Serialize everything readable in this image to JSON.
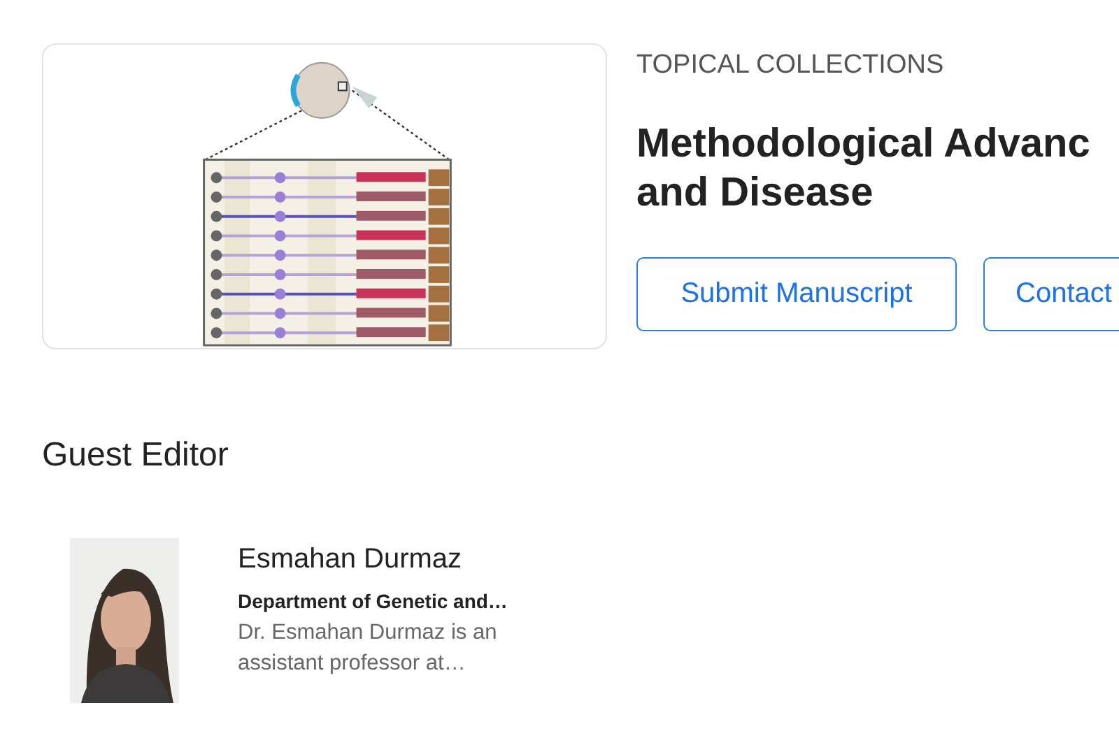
{
  "collection": {
    "eyebrow": "TOPICAL COLLECTIONS",
    "title_lines": [
      "Methodological Advanc",
      "and Disease"
    ],
    "buttons": [
      {
        "label": "Submit Manuscript"
      },
      {
        "label": "Contact"
      }
    ]
  },
  "guest_editor": {
    "heading": "Guest Editor",
    "editors": [
      {
        "name": "Esmahan Durmaz",
        "department": "Department of Genetic and…",
        "bio_lines": [
          "Dr. Esmahan Durmaz is an",
          "assistant professor at…"
        ]
      }
    ]
  }
}
